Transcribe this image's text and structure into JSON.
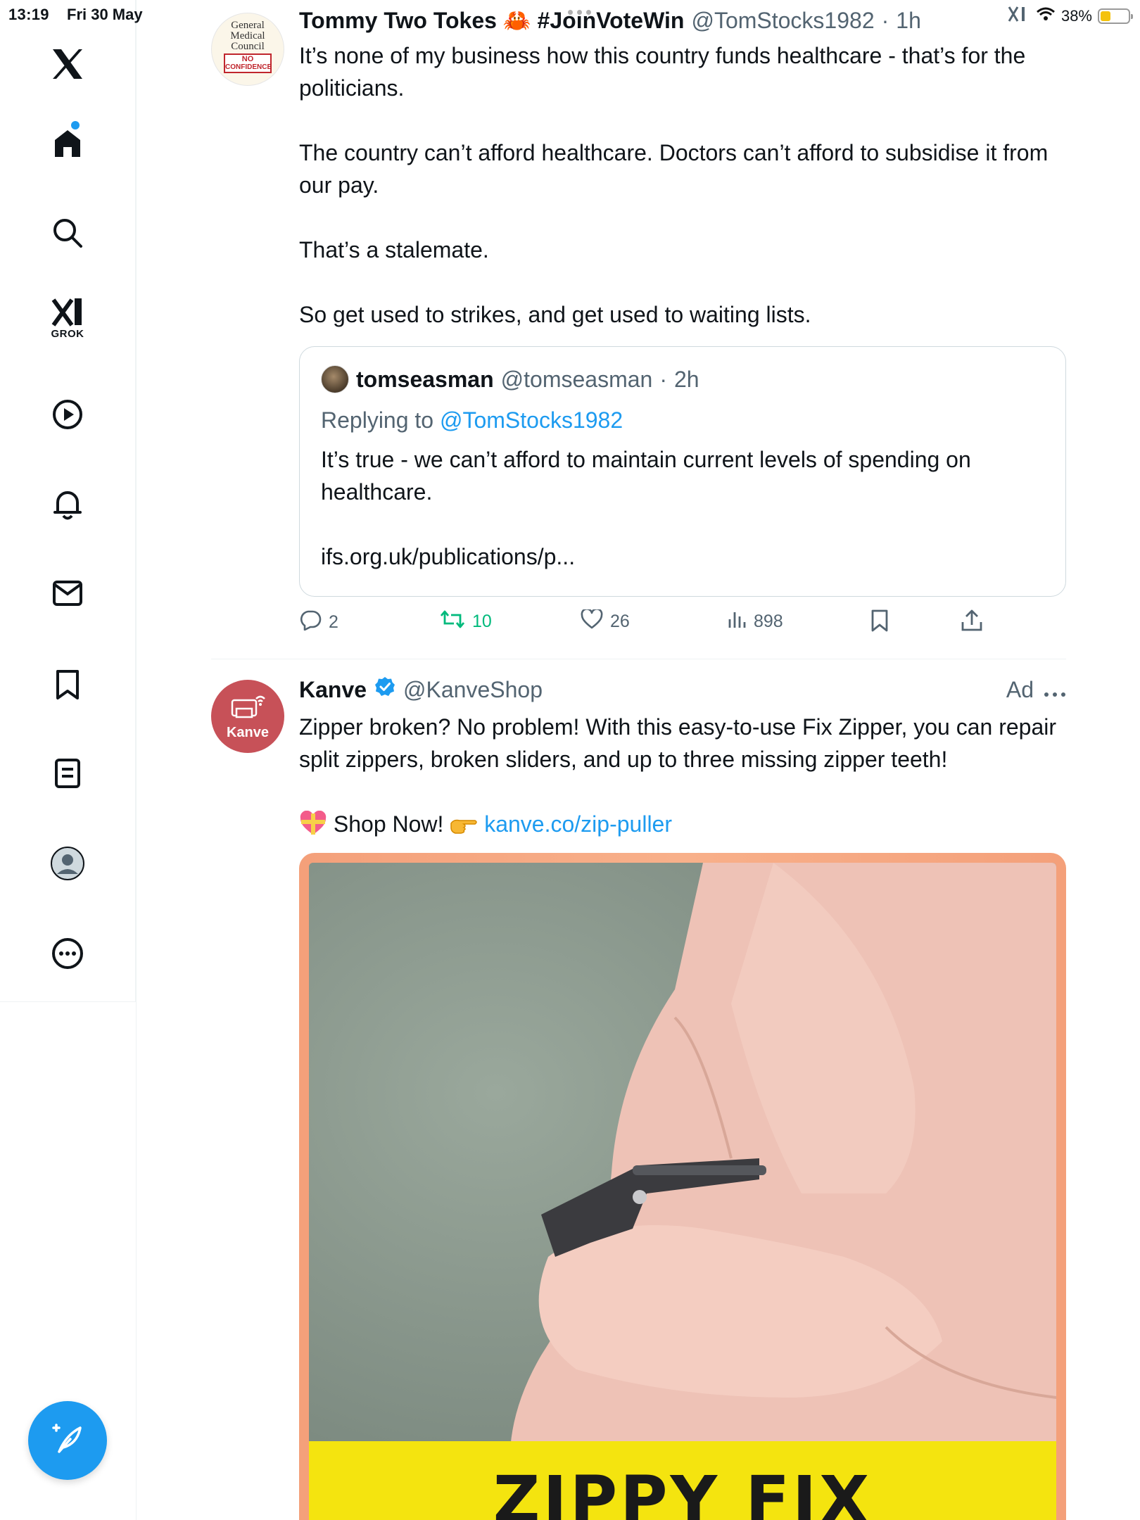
{
  "status_bar": {
    "time": "13:19",
    "date": "Fri 30 May",
    "battery": "38%",
    "battery_level": 0.38
  },
  "sidebar": {
    "items": [
      {
        "name": "x-logo",
        "label": ""
      },
      {
        "name": "home",
        "label": ""
      },
      {
        "name": "search",
        "label": ""
      },
      {
        "name": "grok",
        "label": "GROK"
      },
      {
        "name": "video",
        "label": ""
      },
      {
        "name": "notifications",
        "label": ""
      },
      {
        "name": "messages",
        "label": ""
      },
      {
        "name": "bookmarks",
        "label": ""
      },
      {
        "name": "lists",
        "label": ""
      },
      {
        "name": "profile",
        "label": ""
      },
      {
        "name": "more",
        "label": ""
      }
    ]
  },
  "tweet": {
    "avatar": {
      "line1": "General",
      "line2": "Medical",
      "line3": "Council",
      "badge1": "NO",
      "badge2": "CONFIDENCE"
    },
    "display_name": "Tommy Two Tokes 🦀 #JoinVoteWin",
    "handle": "@TomStocks1982",
    "time": "1h",
    "paragraphs": [
      "It’s none of my business how this country funds healthcare - that’s for the politicians.",
      "The country can’t afford healthcare. Doctors can’t afford to subsidise it from our pay.",
      "That’s a stalemate.",
      "So get used to strikes, and get used to waiting lists."
    ],
    "quote": {
      "display_name": "tomseasman",
      "handle": "@tomseasman",
      "time": "2h",
      "replying_prefix": "Replying to ",
      "replying_to": "@TomStocks1982",
      "text": "It’s true - we can’t afford to maintain current levels of spending on healthcare.",
      "link": "ifs.org.uk/publications/p..."
    },
    "actions": {
      "replies": "2",
      "reposts": "10",
      "likes": "26",
      "views": "898"
    }
  },
  "ad": {
    "avatar_label": "Kanve",
    "display_name": "Kanve",
    "handle": "@KanveShop",
    "ad_label": "Ad",
    "text": "Zipper broken? No problem! With this easy-to-use Fix Zipper, you can repair split zippers, broken sliders, and up to three missing zipper teeth!",
    "cta": "Shop Now!",
    "link": "kanve.co/zip-puller",
    "media_banner": "ZIPPY FIX"
  },
  "colors": {
    "accent": "#1d9bf0",
    "repost": "#00ba7c",
    "secondary_text": "#536471",
    "ad_avatar": "#c75158",
    "banner": "#f4e40f"
  }
}
